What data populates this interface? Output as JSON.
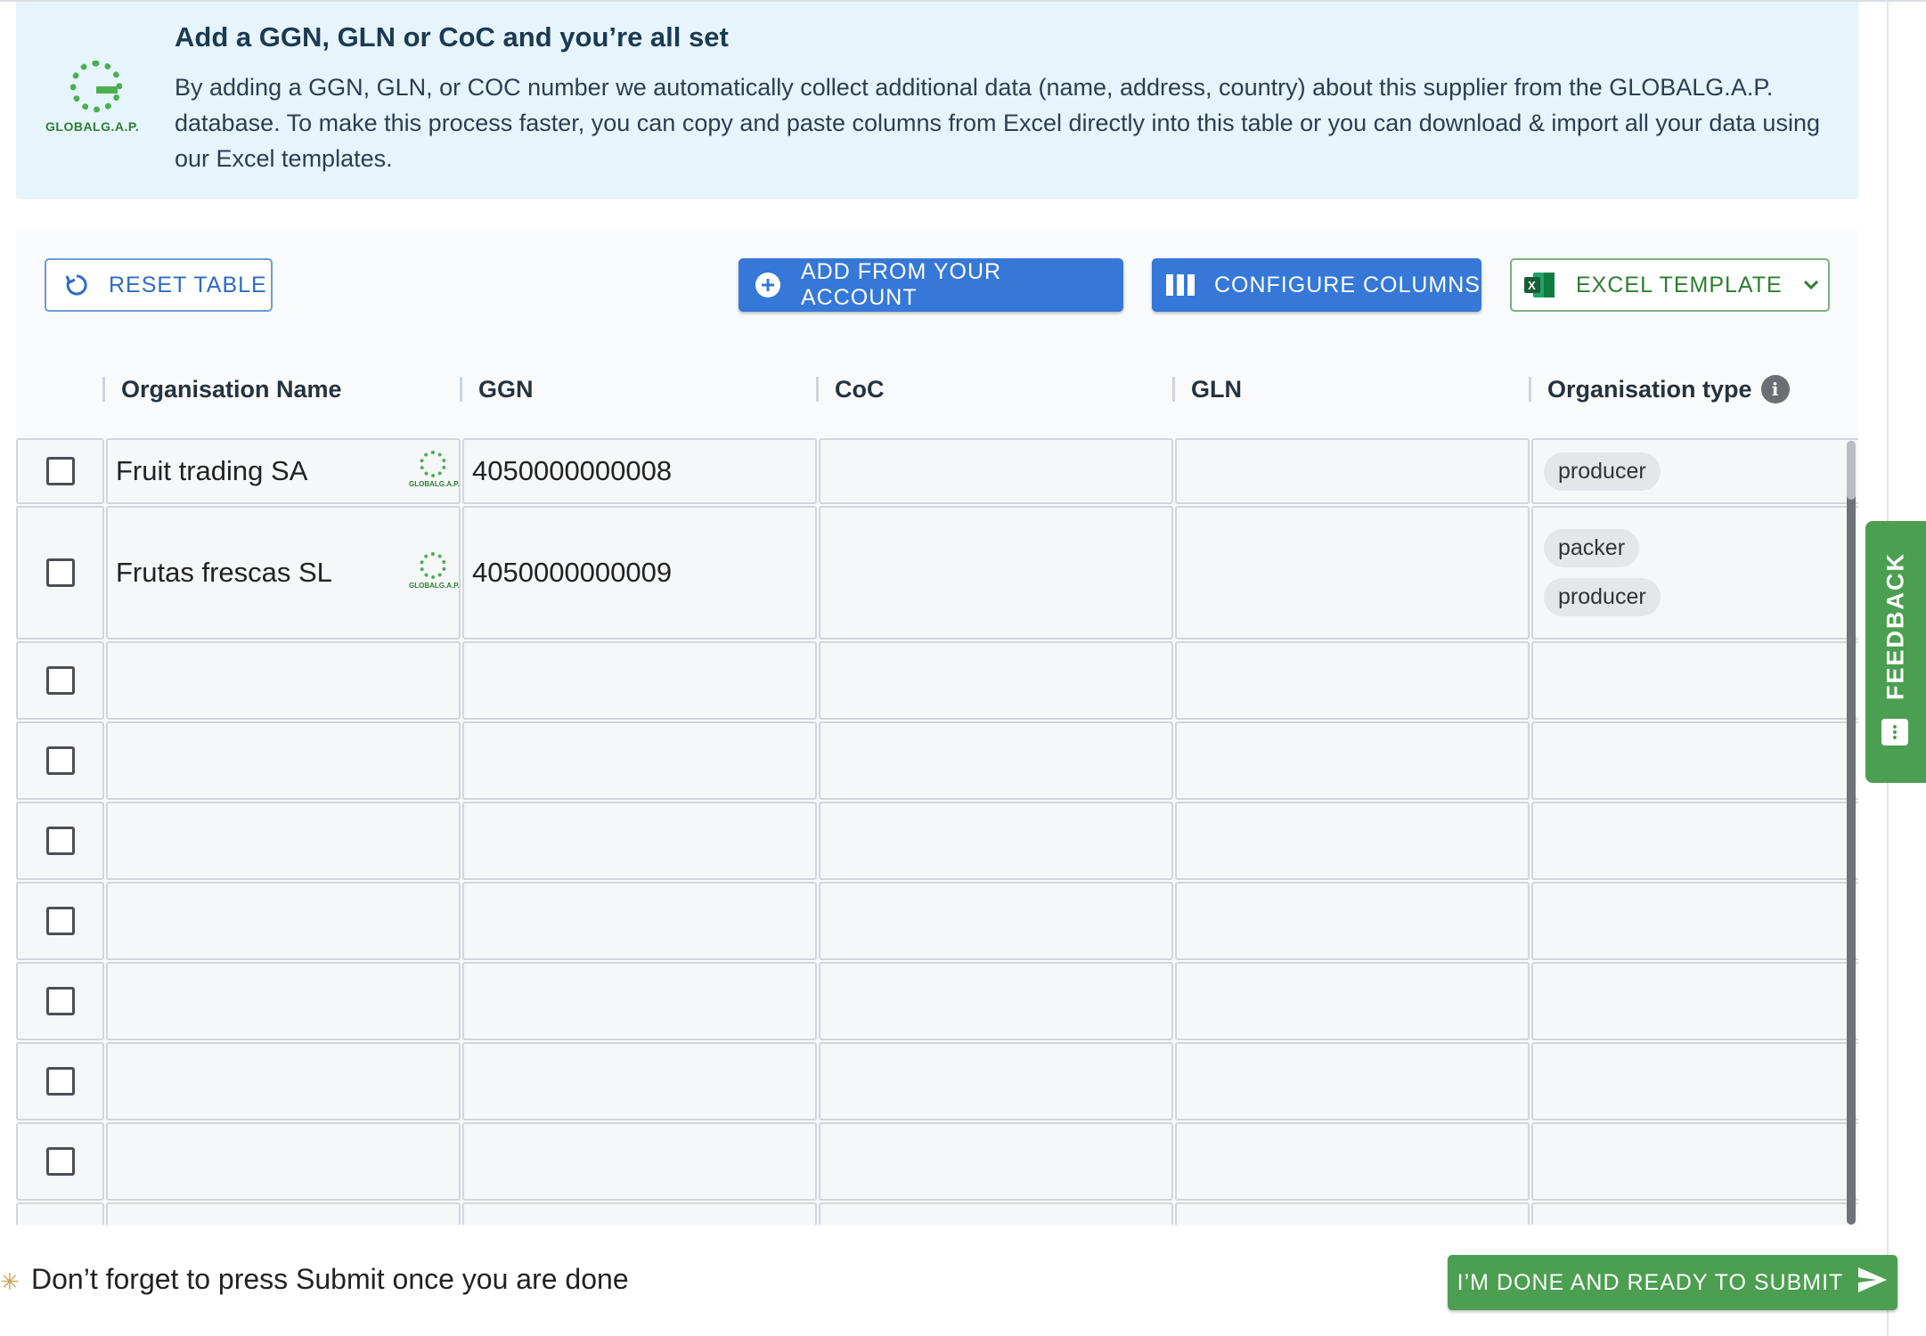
{
  "banner": {
    "title": "Add a GGN, GLN or CoC and you’re all set",
    "description": "By adding a GGN, GLN, or COC number we automatically collect additional data (name, address, country) about this supplier from the GLOBALG.A.P. database. To make this process faster, you can copy and paste columns from Excel directly into this table or you can download & import all your data using our Excel templates.",
    "logo_text": "GLOBALG.A.P."
  },
  "toolbar": {
    "reset_label": "RESET TABLE",
    "add_label": "ADD FROM YOUR ACCOUNT",
    "configure_label": "CONFIGURE COLUMNS",
    "excel_label": "EXCEL TEMPLATE"
  },
  "table": {
    "columns": [
      "Organisation Name",
      "GGN",
      "CoC",
      "GLN",
      "Organisation type"
    ],
    "rows": [
      {
        "name": "Fruit trading SA",
        "ggn": "4050000000008",
        "coc": "",
        "gln": "",
        "types": [
          "producer"
        ]
      },
      {
        "name": "Frutas frescas SL",
        "ggn": "4050000000009",
        "coc": "",
        "gln": "",
        "types": [
          "packer",
          "producer"
        ]
      }
    ],
    "empty_rows": 8
  },
  "feedback_label": "FEEDBACK",
  "footer": {
    "reminder": "Don’t forget to press Submit once you are done",
    "submit_label": "I’M DONE AND READY TO SUBMIT"
  },
  "colors": {
    "primary": "#3678d8",
    "success": "#4c9f50",
    "banner_bg": "#e6f4fb"
  }
}
